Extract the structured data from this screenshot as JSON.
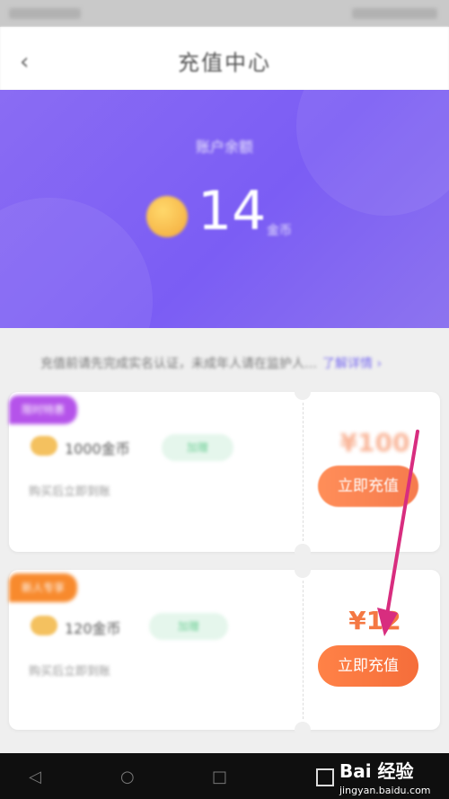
{
  "header": {
    "title": "充值中心",
    "back_glyph": "‹"
  },
  "hero": {
    "subtitle": "账户余额",
    "balance": "14",
    "unit": "金币"
  },
  "notice": {
    "text": "充值前请先完成实名认证，未成年人请在监护人…",
    "link": "了解详情 ›"
  },
  "packages": [
    {
      "tag": "限时特惠",
      "tag_color": "#b553ea",
      "name": "1000金币",
      "badge": "加赠",
      "desc": "购买后立即到账",
      "price": "¥100",
      "button": "立即充值"
    },
    {
      "tag": "新人专享",
      "tag_color": "#f88a2d",
      "name": "120金币",
      "badge": "加赠",
      "desc": "购买后立即到账",
      "price": "¥12",
      "button": "立即充值"
    }
  ],
  "navbar": {
    "back": "◁",
    "home": "○",
    "recents": "□"
  },
  "watermark": {
    "brand": "Bai 经验",
    "url": "jingyan.baidu.com"
  },
  "annotation": {
    "color": "#d82d7f"
  }
}
